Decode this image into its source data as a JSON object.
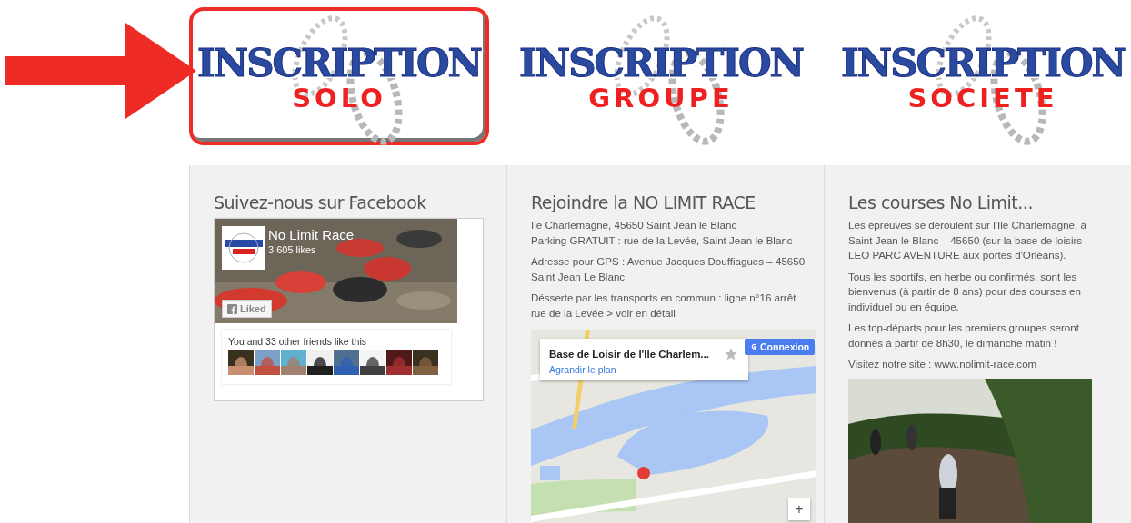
{
  "banners": [
    {
      "title": "INSCRIPTION",
      "subtitle": "SOLO",
      "selected": true
    },
    {
      "title": "INSCRIPTION",
      "subtitle": "GROUPE",
      "selected": false
    },
    {
      "title": "INSCRIPTION",
      "subtitle": "SOCIETE",
      "selected": false
    }
  ],
  "facebook": {
    "heading": "Suivez-nous sur Facebook",
    "page_name": "No Limit Race",
    "likes": "3,605 likes",
    "like_button": "Liked",
    "friends_text": "You and 33 other friends like this"
  },
  "join": {
    "heading": "Rejoindre la NO LIMIT RACE",
    "paragraphs": [
      [
        "Ile Charlemagne, 45650 Saint Jean le Blanc",
        "Parking GRATUIT : rue de la Levée, Saint Jean le Blanc"
      ],
      [
        "Adresse pour GPS : Avenue Jacques Douffiagues – 45650 Saint Jean Le Blanc"
      ],
      [
        "Désserte par les transports en commun : ligne n°16 arrêt rue de la Levée > voir en détail"
      ]
    ],
    "map": {
      "place_title": "Base de Loisir de l'Ile Charlem...",
      "enlarge_link": "Agrandir le plan",
      "sign_in_button": "Connexion",
      "zoom_in": "+"
    }
  },
  "courses": {
    "heading": "Les courses No Limit...",
    "paragraphs": [
      "Les épreuves se déroulent sur l'Ile Charlemagne, à Saint Jean le Blanc – 45650 (sur la base de loisirs LEO PARC AVENTURE aux portes d'Orléans).",
      "Tous les sportifs, en herbe ou confirmés, sont les bienvenus (à partir de 8 ans) pour des courses en individuel ou en équipe.",
      "Les top-départs pour les premiers groupes seront donnés à partir de 8h30, le dimanche matin !",
      "Visitez notre site : www.nolimit-race.com"
    ]
  }
}
